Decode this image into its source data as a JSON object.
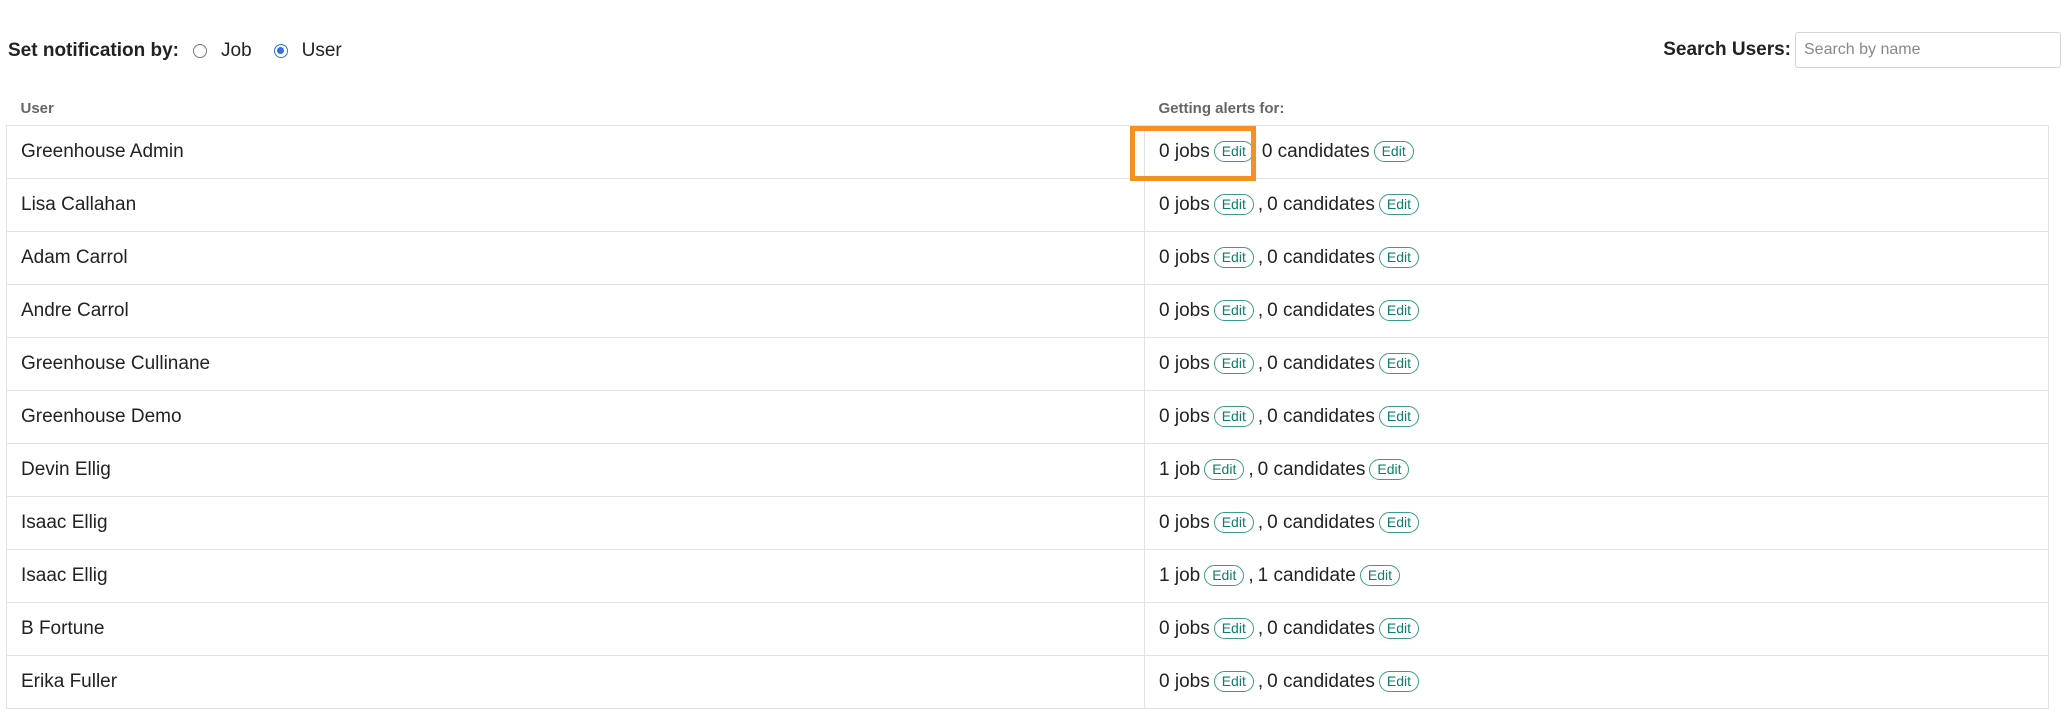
{
  "toolbar": {
    "notify_label": "Set notification by:",
    "options": [
      {
        "label": "Job",
        "checked": false
      },
      {
        "label": "User",
        "checked": true
      }
    ],
    "search_label": "Search Users:",
    "search_placeholder": "Search by name",
    "search_value": ""
  },
  "table": {
    "headers": [
      "User",
      "Getting alerts for:"
    ],
    "edit_label": "Edit",
    "rows": [
      {
        "user": "Greenhouse Admin",
        "jobs": "0 jobs",
        "candidates": "0 candidates",
        "sep": ""
      },
      {
        "user": "Lisa Callahan",
        "jobs": "0 jobs",
        "candidates": "0 candidates",
        "sep": ","
      },
      {
        "user": "Adam Carrol",
        "jobs": "0 jobs",
        "candidates": "0 candidates",
        "sep": ","
      },
      {
        "user": "Andre Carrol",
        "jobs": "0 jobs",
        "candidates": "0 candidates",
        "sep": ","
      },
      {
        "user": "Greenhouse Cullinane",
        "jobs": "0 jobs",
        "candidates": "0 candidates",
        "sep": ","
      },
      {
        "user": "Greenhouse Demo",
        "jobs": "0 jobs",
        "candidates": "0 candidates",
        "sep": ","
      },
      {
        "user": "Devin Ellig",
        "jobs": "1 job",
        "candidates": "0 candidates",
        "sep": ","
      },
      {
        "user": "Isaac Ellig",
        "jobs": "0 jobs",
        "candidates": "0 candidates",
        "sep": ","
      },
      {
        "user": "Isaac Ellig",
        "jobs": "1 job",
        "candidates": "1 candidate",
        "sep": ","
      },
      {
        "user": "B Fortune",
        "jobs": "0 jobs",
        "candidates": "0 candidates",
        "sep": ","
      },
      {
        "user": "Erika Fuller",
        "jobs": "0 jobs",
        "candidates": "0 candidates",
        "sep": ","
      }
    ]
  },
  "colors": {
    "highlight": "#f7901e",
    "edit_text": "#0e7d6a",
    "radio_selected": "#2f6fde"
  }
}
